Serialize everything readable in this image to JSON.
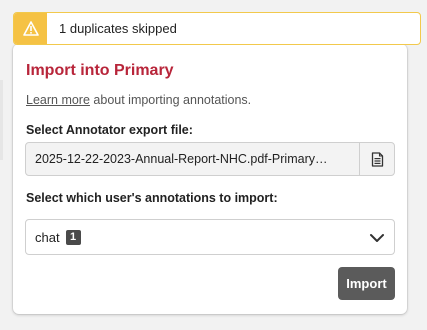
{
  "toast": {
    "icon": "warning-icon",
    "message": "1 duplicates skipped",
    "colors": {
      "accent": "#f5c244",
      "border": "#f2c94c"
    }
  },
  "panel": {
    "title": "Import into Primary",
    "title_color": "#b8253a",
    "learn_more_link": "Learn more",
    "learn_more_rest": " about importing annotations.",
    "file_label": "Select Annotator export file:",
    "file_value": "2025-12-22-2023-Annual-Report-NHC.pdf-Primary…",
    "file_button_icon": "document-icon",
    "user_label": "Select which user's annotations to import:",
    "selected_user": "chat",
    "selected_user_count": "1",
    "dropdown_icon": "chevron-down-icon",
    "import_label": "Import"
  }
}
